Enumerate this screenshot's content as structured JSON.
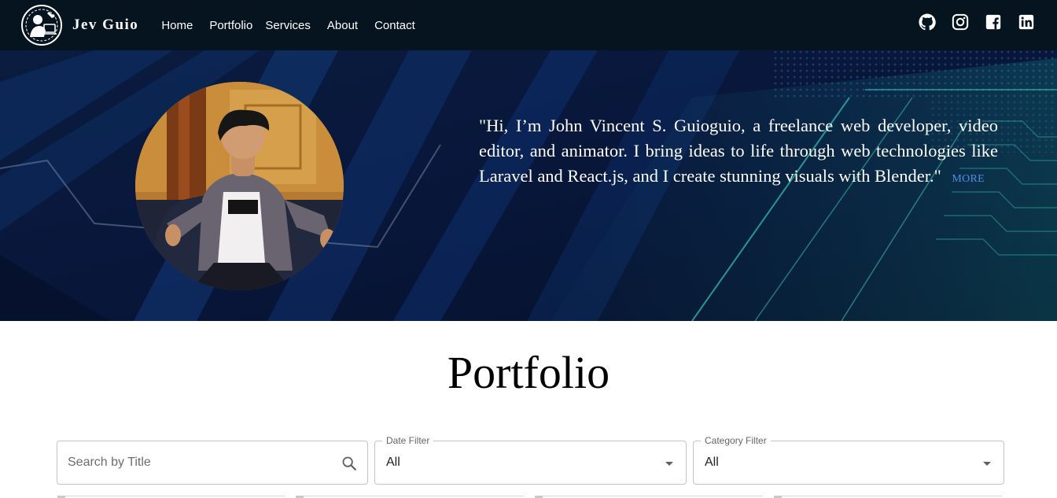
{
  "brand": {
    "name": "Jev Guio",
    "logo_icon": "developer-logo-icon"
  },
  "nav": {
    "items": [
      {
        "label": "Home"
      },
      {
        "label": "Portfolio"
      },
      {
        "label": "Services"
      },
      {
        "label": "About"
      },
      {
        "label": "Contact"
      }
    ]
  },
  "social": {
    "icons": [
      "github-icon",
      "instagram-icon",
      "facebook-icon",
      "linkedin-icon"
    ]
  },
  "hero": {
    "quote": "\"Hi, I’m John Vincent S. Guioguio, a freelance web developer, video editor, and animator. I bring ideas to life through web technologies like Laravel and React.js, and I create stunning visuals with Blender.\"",
    "more_label": "MORE"
  },
  "portfolio": {
    "title": "Portfolio",
    "search": {
      "placeholder": "Search by Title"
    },
    "date_filter": {
      "label": "Date Filter",
      "value": "All"
    },
    "category_filter": {
      "label": "Category Filter",
      "value": "All"
    }
  },
  "colors": {
    "navbar_bg": "#06141f",
    "hero_bg": "#07132e",
    "accent_link": "#4a8fe8"
  }
}
